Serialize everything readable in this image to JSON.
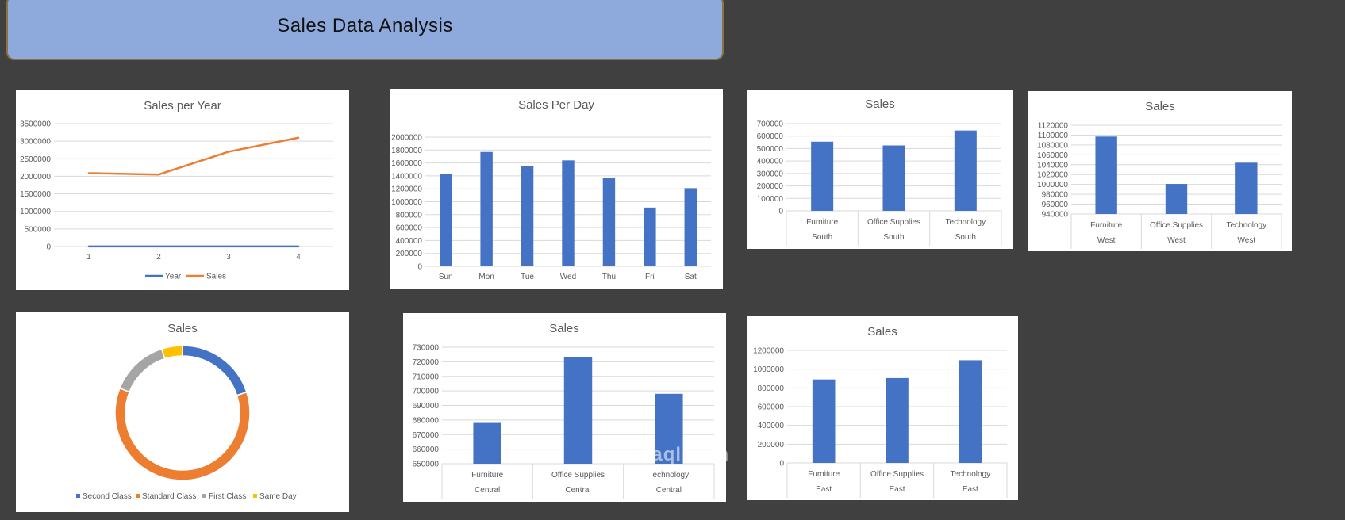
{
  "page": {
    "title": "Sales Data Analysis",
    "watermark": "mostaql.com"
  },
  "colors": {
    "blue": "#4472c4",
    "orange": "#ed7d31",
    "gray": "#a5a5a5",
    "yellow": "#ffc000"
  },
  "chart_data": [
    {
      "id": "line",
      "type": "line",
      "title": "Sales per Year",
      "categories": [
        "1",
        "2",
        "3",
        "4"
      ],
      "ylim": [
        0,
        3500000
      ],
      "yticks": [
        0,
        500000,
        1000000,
        1500000,
        2000000,
        2500000,
        3000000,
        3500000
      ],
      "series": [
        {
          "name": "Year",
          "values": [
            2014,
            2015,
            2016,
            2017
          ],
          "color": "#4472c4"
        },
        {
          "name": "Sales",
          "values": [
            2090000,
            2050000,
            2700000,
            3100000
          ],
          "color": "#ed7d31"
        }
      ],
      "legend": "bottom",
      "grid": true
    },
    {
      "id": "day",
      "type": "bar",
      "title": "Sales Per Day",
      "categories": [
        "Sun",
        "Mon",
        "Tue",
        "Wed",
        "Thu",
        "Fri",
        "Sat"
      ],
      "values": [
        1430000,
        1770000,
        1550000,
        1640000,
        1370000,
        910000,
        1210000
      ],
      "ylim": [
        0,
        2000000
      ],
      "yticks": [
        0,
        200000,
        400000,
        600000,
        800000,
        1000000,
        1200000,
        1400000,
        1600000,
        1800000,
        2000000
      ],
      "grid": true
    },
    {
      "id": "south",
      "type": "bar",
      "title": "Sales",
      "categories": [
        "Furniture",
        "Office Supplies",
        "Technology"
      ],
      "subcategories": [
        "South",
        "South",
        "South"
      ],
      "values": [
        555000,
        525000,
        645000
      ],
      "ylim": [
        0,
        700000
      ],
      "yticks": [
        0,
        100000,
        200000,
        300000,
        400000,
        500000,
        600000,
        700000
      ],
      "grid": true
    },
    {
      "id": "west",
      "type": "bar",
      "title": "Sales",
      "categories": [
        "Furniture",
        "Office Supplies",
        "Technology"
      ],
      "subcategories": [
        "West",
        "West",
        "West"
      ],
      "values": [
        1097000,
        1001000,
        1044000
      ],
      "ylim": [
        940000,
        1120000
      ],
      "yticks": [
        940000,
        960000,
        980000,
        1000000,
        1020000,
        1040000,
        1060000,
        1080000,
        1100000,
        1120000
      ],
      "grid": true
    },
    {
      "id": "donut",
      "type": "pie",
      "title": "Sales",
      "categories": [
        "Second Class",
        "Standard Class",
        "First Class",
        "Same Day"
      ],
      "values": [
        20,
        61,
        14,
        5
      ],
      "colors": [
        "#4472c4",
        "#ed7d31",
        "#a5a5a5",
        "#ffc000"
      ],
      "legend": "bottom"
    },
    {
      "id": "central",
      "type": "bar",
      "title": "Sales",
      "categories": [
        "Furniture",
        "Office Supplies",
        "Technology"
      ],
      "subcategories": [
        "Central",
        "Central",
        "Central"
      ],
      "values": [
        678000,
        723000,
        698000
      ],
      "ylim": [
        650000,
        730000
      ],
      "yticks": [
        650000,
        660000,
        670000,
        680000,
        690000,
        700000,
        710000,
        720000,
        730000
      ],
      "grid": true
    },
    {
      "id": "east",
      "type": "bar",
      "title": "Sales",
      "categories": [
        "Furniture",
        "Office Supplies",
        "Technology"
      ],
      "subcategories": [
        "East",
        "East",
        "East"
      ],
      "values": [
        890000,
        905000,
        1095000
      ],
      "ylim": [
        0,
        1200000
      ],
      "yticks": [
        0,
        200000,
        400000,
        600000,
        800000,
        1000000,
        1200000
      ],
      "grid": true
    }
  ]
}
